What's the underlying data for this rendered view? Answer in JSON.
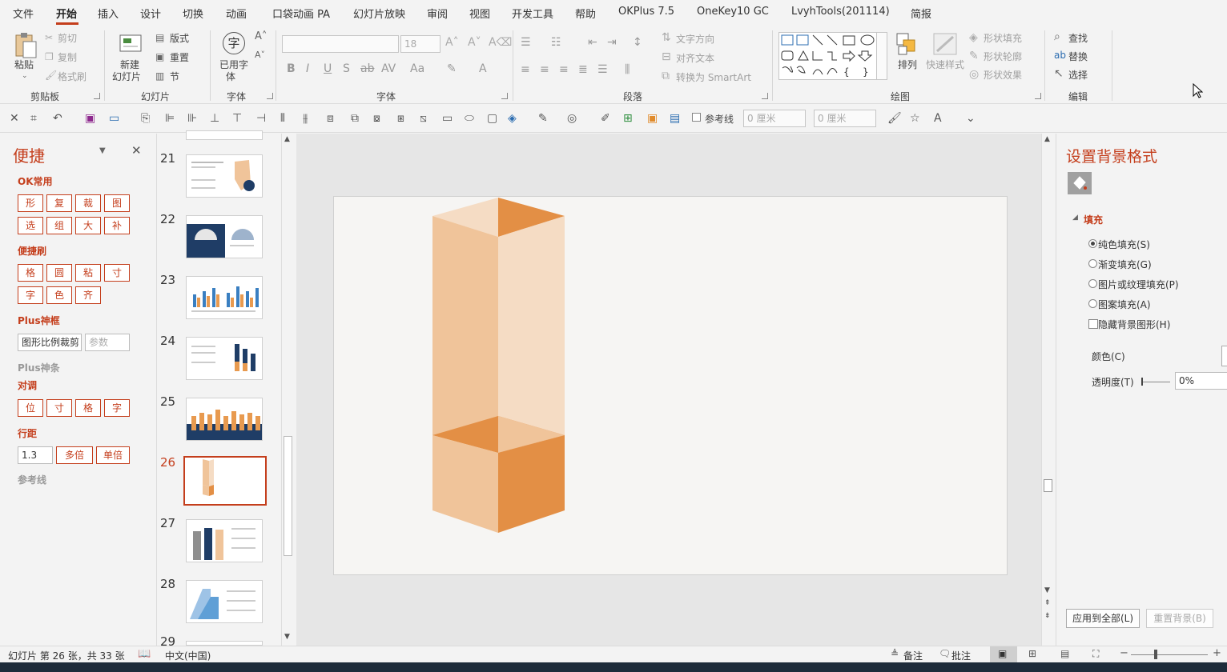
{
  "menu": {
    "tabs": [
      "文件",
      "开始",
      "插入",
      "设计",
      "切换",
      "动画",
      "口袋动画 PA",
      "幻灯片放映",
      "审阅",
      "视图",
      "开发工具",
      "帮助",
      "OKPlus 7.5",
      "OneKey10 GC",
      "LvyhTools(201114)",
      "简报"
    ],
    "active": "开始"
  },
  "ribbon": {
    "clipboard": {
      "label": "剪贴板",
      "paste": "粘贴",
      "cut": "剪切",
      "copy": "复制",
      "format_painter": "格式刷"
    },
    "slides": {
      "label": "幻灯片",
      "new_slide_1": "新建",
      "new_slide_2": "幻灯片",
      "layout": "版式",
      "reset": "重置",
      "section": "节"
    },
    "fontgroup": {
      "label": "字体",
      "used_font_1": "已用字",
      "used_font_2": "体",
      "font_size": "18",
      "glyph": "字"
    },
    "paragraph": {
      "label": "段落",
      "text_direction": "文字方向",
      "align_text": "对齐文本",
      "smartart": "转换为 SmartArt"
    },
    "drawing": {
      "label": "绘图",
      "arrange": "排列",
      "quick_styles": "快速样式",
      "shape_fill": "形状填充",
      "shape_outline": "形状轮廓",
      "shape_effects": "形状效果"
    },
    "editing": {
      "label": "编辑",
      "find": "查找",
      "replace": "替换",
      "select": "选择"
    },
    "font_section_label": "字体"
  },
  "qat": {
    "guides": "参考线",
    "width": "0 厘米",
    "height": "0 厘米"
  },
  "left_pane": {
    "title": "便捷",
    "ok_common": "OK常用",
    "row1": [
      "形",
      "复",
      "裁",
      "图"
    ],
    "row2": [
      "选",
      "组",
      "大",
      "补"
    ],
    "brush": "便捷刷",
    "row3": [
      "格",
      "圆",
      "粘",
      "寸"
    ],
    "row4": [
      "字",
      "色",
      "齐"
    ],
    "plus_frame": "Plus神框",
    "crop_field": "图形比例裁剪",
    "param_placeholder": "参数",
    "plus_bar": "Plus神条",
    "align": "对调",
    "row5": [
      "位",
      "寸",
      "格",
      "字"
    ],
    "line_spacing": "行距",
    "spacing_value": "1.3",
    "multi": "多倍",
    "single": "单倍",
    "guides": "参考线"
  },
  "thumbnails": {
    "numbers": [
      "21",
      "22",
      "23",
      "24",
      "25",
      "26",
      "27",
      "28",
      "29"
    ],
    "active": "26"
  },
  "right_pane": {
    "title": "设置背景格式",
    "fill": "填充",
    "options": [
      "纯色填充(S)",
      "渐变填充(G)",
      "图片或纹理填充(P)",
      "图案填充(A)"
    ],
    "hide_bg": "隐藏背景图形(H)",
    "color": "颜色(C)",
    "transparency": "透明度(T)",
    "transparency_value": "0%",
    "apply_all": "应用到全部(L)",
    "reset_bg": "重置背景(B)"
  },
  "status": {
    "slide_info": "幻灯片 第 26 张，共 33 张",
    "language": "中文(中国)",
    "notes": "备注",
    "comments": "批注",
    "zoom_minus": "−",
    "zoom_plus": "+"
  },
  "colors": {
    "accent": "#c43e1c",
    "orange_dark": "#e38f45",
    "orange_light": "#f0c49a",
    "orange_pale": "#f5dcc4"
  }
}
